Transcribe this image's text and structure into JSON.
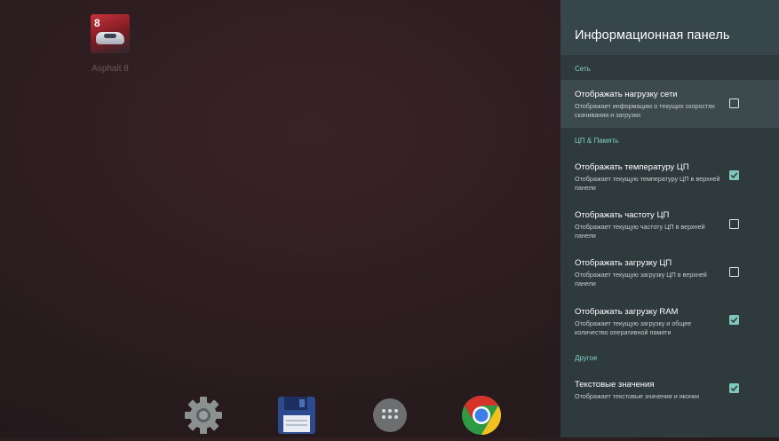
{
  "desktop": {
    "app": {
      "name": "Asphalt 8",
      "badge": "8"
    },
    "dock": [
      {
        "icon": "settings-gear-icon"
      },
      {
        "icon": "floppy-disk-icon"
      },
      {
        "icon": "app-drawer-icon"
      },
      {
        "icon": "chrome-icon"
      }
    ]
  },
  "panel": {
    "title": "Информационная панель",
    "sections": [
      {
        "label": "Сеть"
      },
      {
        "label": "ЦП & Память"
      },
      {
        "label": "Другое"
      }
    ],
    "items": [
      {
        "title": "Отображать нагрузку сети",
        "subtitle": "Отображает информацию о текущих скоростях скачивания и загрузки",
        "checked": false,
        "focused": true
      },
      {
        "title": "Отображать температуру ЦП",
        "subtitle": "Отображает текущую температуру ЦП в верхней панели",
        "checked": true,
        "focused": false
      },
      {
        "title": "Отображать частоту ЦП",
        "subtitle": "Отображает текущую частоту ЦП в верхней панели",
        "checked": false,
        "focused": false
      },
      {
        "title": "Отображать загрузку ЦП",
        "subtitle": "Отображает текущую загрузку ЦП в верхней панели",
        "checked": false,
        "focused": false
      },
      {
        "title": "Отображать загрузку RAM",
        "subtitle": "Отображает текущую загрузку и общее количество оперативной памяти",
        "checked": true,
        "focused": false
      },
      {
        "title": "Текстовые значения",
        "subtitle": "Отображает текстовые значения и иконки",
        "checked": true,
        "focused": false
      }
    ],
    "colors": {
      "accent": "#7ec8bd",
      "panel_bg": "#2f3a3d",
      "header_bg": "#37464a"
    }
  }
}
